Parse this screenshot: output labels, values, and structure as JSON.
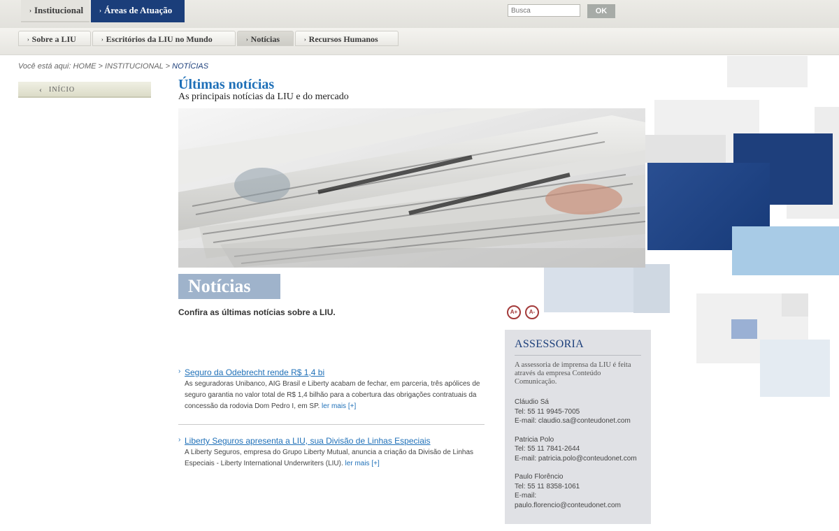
{
  "top_nav": {
    "tabs": [
      {
        "label": "Institucional"
      },
      {
        "label": "Áreas de Atuação"
      }
    ],
    "search_placeholder": "Busca",
    "ok_label": "OK"
  },
  "sub_nav": {
    "tabs": [
      {
        "label": "Sobre a LIU"
      },
      {
        "label": "Escritórios da LIU no Mundo"
      },
      {
        "label": "Notícias"
      },
      {
        "label": "Recursos Humanos"
      }
    ],
    "active": "Notícias"
  },
  "breadcrumb": {
    "prefix": "Você está aqui:",
    "home": "HOME",
    "sep": ">",
    "section": "INSTITUCIONAL",
    "current": "NOTÍCIAS"
  },
  "side_nav": {
    "inicio_label": "INÍCIO"
  },
  "main": {
    "title": "Últimas notícias",
    "subtitle": "As principais notícias da LIU e do mercado",
    "section_heading": "Notícias",
    "intro": "Confira as últimas notícias sobre a LIU.",
    "font_increase": "A+",
    "font_decrease": "A-",
    "news": [
      {
        "headline": "Seguro da Odebrecht rende R$ 1,4 bi",
        "body": "As seguradoras Unibanco, AIG Brasil e Liberty acabam de fechar, em parceria, três apólices de seguro garantia no valor total de R$ 1,4 bilhão para a cobertura das obrigações contratuais da concessão da rodovia Dom Pedro I, em SP.",
        "more": "ler mais [+]"
      },
      {
        "headline": "Liberty Seguros apresenta a LIU, sua Divisão de Linhas Especiais",
        "body": "A Liberty Seguros, empresa do Grupo Liberty Mutual, anuncia a criação da Divisão de Linhas Especiais - Liberty International Underwriters (LIU).",
        "more": "ler mais [+]"
      }
    ]
  },
  "assessoria": {
    "title": "ASSESSORIA",
    "description": "A assessoria de imprensa da LIU é feita através da empresa Conteúdo Comunicação.",
    "contacts": [
      {
        "name": "Cláudio Sá",
        "tel": "Tel: 55 11 9945-7005",
        "email": "E-mail: claudio.sa@conteudonet.com"
      },
      {
        "name": "Patricia Polo",
        "tel": "Tel: 55 11 7841-2644",
        "email": "E-mail: patricia.polo@conteudonet.com"
      },
      {
        "name": "Paulo Florêncio",
        "tel": "Tel: 55 11 8358-1061",
        "email_label": "E-mail:",
        "email": "paulo.florencio@conteudonet.com"
      }
    ]
  },
  "colors": {
    "brand_navy": "#1b3e7a",
    "link_blue": "#1f70b8",
    "heading_tile": "#9fb3cb",
    "font_button_red": "#a33a3a"
  }
}
